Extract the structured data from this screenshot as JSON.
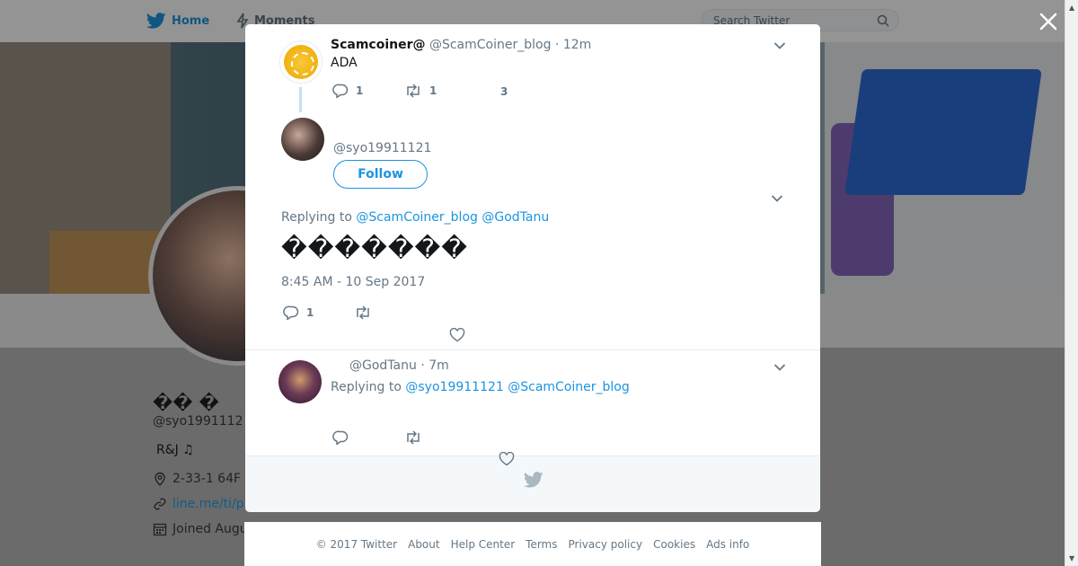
{
  "topbar": {
    "home_label": "Home",
    "moments_label": "Moments",
    "search_placeholder": "Search Twitter"
  },
  "profile": {
    "name": "�� �",
    "handle": "@syo1991112",
    "bio": "R&J ♫",
    "location": "2-33-1 64F",
    "url": "line.me/ti/p",
    "joined": "Joined Augu"
  },
  "tweet1": {
    "name": "Scamcoiner@",
    "handle": "@ScamCoiner_blog",
    "time": "· 12m",
    "text": "ADA",
    "reply_count": "1",
    "retweet_count": "1",
    "like_count": "3"
  },
  "main_tweet": {
    "handle": "@syo19911121",
    "follow_label": "Follow",
    "replying_prefix": "Replying to",
    "reply_to_1": "@ScamCoiner_blog",
    "reply_to_2": "@GodTanu",
    "text": "�������",
    "timestamp": "8:45 AM - 10 Sep 2017",
    "reply_count": "1"
  },
  "reply_tweet": {
    "handle": "@GodTanu",
    "time": "· 7m",
    "replying_prefix": "Replying to",
    "reply_to_1": "@syo19911121",
    "reply_to_2": "@ScamCoiner_blog"
  },
  "footer": {
    "copyright": "© 2017 Twitter",
    "about": "About",
    "help": "Help Center",
    "terms": "Terms",
    "privacy": "Privacy policy",
    "cookies": "Cookies",
    "ads": "Ads info"
  },
  "colors": {
    "accent": "#1b95e0",
    "text": "#14171a",
    "muted": "#657786"
  },
  "icons": [
    "twitter-bird-icon",
    "lightning-icon",
    "search-icon",
    "close-icon",
    "chevron-down-icon",
    "reply-icon",
    "retweet-icon",
    "heart-icon",
    "location-icon",
    "link-icon",
    "calendar-icon"
  ]
}
